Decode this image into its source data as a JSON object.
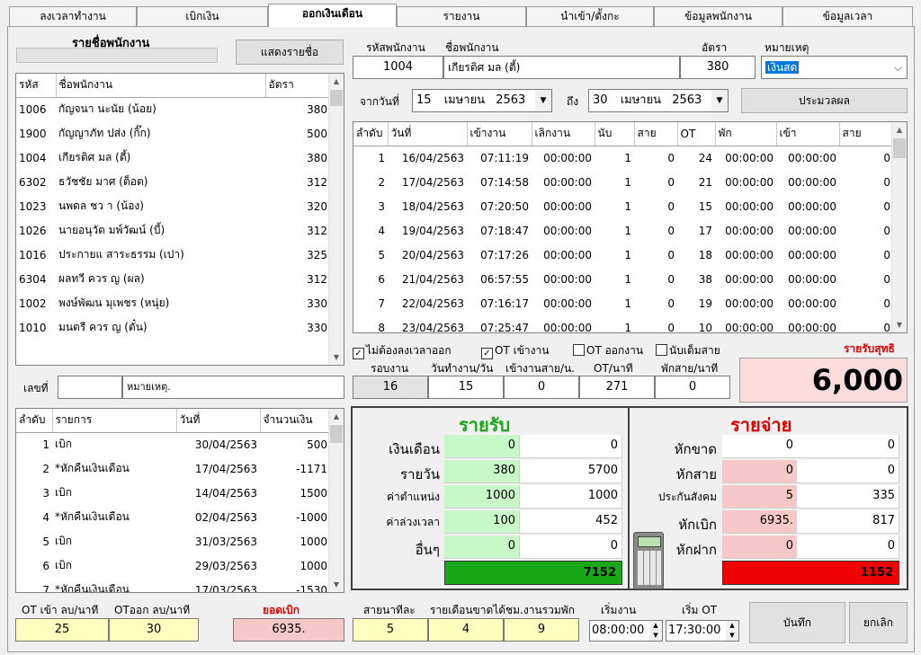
{
  "tabs": [
    "ลงเวลาทำงาน",
    "เบิกเงิน",
    "ออกเงินเดือน",
    "รายงาน",
    "นำเข้า/ตั้งกะ",
    "ข้อมูลพนักงาน",
    "ข้อมูลเวลา"
  ],
  "left": {
    "title": "รายชื่อพนักงาน",
    "show_button": "แสดงรายชื่อ",
    "headers": [
      "รหัส",
      "ชื่อพนักงาน",
      "อัตรา"
    ],
    "employees": [
      {
        "id": "1006",
        "name": "กัญจนา      นะนัย (น้อย)",
        "rate": "380"
      },
      {
        "id": "1900",
        "name": "กัญญาภัท      ปส่ง (กิ๊ก)",
        "rate": "500"
      },
      {
        "id": "1004",
        "name": "เกียรติศ      มล (ตี้)",
        "rate": "380"
      },
      {
        "id": "6302",
        "name": "ธวัชชัย      มาศ (ต็อต)",
        "rate": "312"
      },
      {
        "id": "1023",
        "name": "นพดล ชว      า (น้อง)",
        "rate": "320"
      },
      {
        "id": "1026",
        "name": "นายอนุวัต      มพ์วัฒน์ (บี้)",
        "rate": "312"
      },
      {
        "id": "1016",
        "name": "ประกายแ      สาระธรรม (เปา)",
        "rate": "325"
      },
      {
        "id": "6304",
        "name": "ผลทวี ควร      ญ (ผล)",
        "rate": "312"
      },
      {
        "id": "1002",
        "name": "พงษ์พัฒน      มุเพชร (หนุ่ย)",
        "rate": "330"
      },
      {
        "id": "1010",
        "name": "มนตรี ควร      ญ (ตั๋น)",
        "rate": "330"
      }
    ],
    "doc_label": "เลขที่",
    "note_label": "หมายเหตุ.",
    "tx_headers": [
      "ลำดับ",
      "รายการ",
      "วันที่",
      "จำนวนเงิน"
    ],
    "transactions": [
      {
        "no": "1",
        "item": "เบิก",
        "date": "30/04/2563",
        "amount": "500"
      },
      {
        "no": "2",
        "item": "*หักคืนเงินเดือน",
        "date": "17/04/2563",
        "amount": "-1171"
      },
      {
        "no": "3",
        "item": "เบิก",
        "date": "14/04/2563",
        "amount": "1500"
      },
      {
        "no": "4",
        "item": "*หักคืนเงินเดือน",
        "date": "02/04/2563",
        "amount": "-1000"
      },
      {
        "no": "5",
        "item": "เบิก",
        "date": "31/03/2563",
        "amount": "1000"
      },
      {
        "no": "6",
        "item": "เบิก",
        "date": "29/03/2563",
        "amount": "1000"
      },
      {
        "no": "7",
        "item": "*หักคืนเงินเดือน",
        "date": "17/03/2563",
        "amount": "-1530"
      }
    ]
  },
  "header": {
    "emp_id_label": "รหัสพนักงาน",
    "emp_name_label": "ชื่อพนักงาน",
    "rate_label": "อัตรา",
    "note_label": "หมายเหตุ",
    "emp_id": "1004",
    "emp_name": "เกียรติศ      มล (ตี้)",
    "rate": "380",
    "note": "เงินสด",
    "from_label": "จากวันที่",
    "from_day": "15",
    "from_month": "เมษายน",
    "from_year": "2563",
    "to_label": "ถึง",
    "to_day": "30",
    "to_month": "เมษายน",
    "to_year": "2563",
    "process_button": "ประมวลผล"
  },
  "attendance": {
    "headers": [
      "ลำดับ",
      "วันที่",
      "เข้างาน",
      "เลิกงาน",
      "นับ",
      "สาย",
      "OT",
      "พัก",
      "เข้า",
      "สาย"
    ],
    "rows": [
      [
        "1",
        "16/04/2563",
        "07:11:19",
        "00:00:00",
        "1",
        "0",
        "24",
        "00:00:00",
        "00:00:00",
        "0"
      ],
      [
        "2",
        "17/04/2563",
        "07:14:58",
        "00:00:00",
        "1",
        "0",
        "21",
        "00:00:00",
        "00:00:00",
        "0"
      ],
      [
        "3",
        "18/04/2563",
        "07:20:50",
        "00:00:00",
        "1",
        "0",
        "15",
        "00:00:00",
        "00:00:00",
        "0"
      ],
      [
        "4",
        "19/04/2563",
        "07:18:47",
        "00:00:00",
        "1",
        "0",
        "17",
        "00:00:00",
        "00:00:00",
        "0"
      ],
      [
        "5",
        "20/04/2563",
        "07:17:26",
        "00:00:00",
        "1",
        "0",
        "18",
        "00:00:00",
        "00:00:00",
        "0"
      ],
      [
        "6",
        "21/04/2563",
        "06:57:55",
        "00:00:00",
        "1",
        "0",
        "38",
        "00:00:00",
        "00:00:00",
        "0"
      ],
      [
        "7",
        "22/04/2563",
        "07:16:17",
        "00:00:00",
        "1",
        "0",
        "19",
        "00:00:00",
        "00:00:00",
        "0"
      ],
      [
        "8",
        "23/04/2563",
        "07:25:47",
        "00:00:00",
        "1",
        "0",
        "10",
        "00:00:00",
        "00:00:00",
        "0"
      ]
    ]
  },
  "options": {
    "no_checkout": "ไม่ต้องลงเวลาออก",
    "ot_in": "OT เข้างาน",
    "ot_out": "OT ออกงาน",
    "count_late": "นับเต็มสาย",
    "no_checkout_checked": true,
    "ot_in_checked": true,
    "ot_out_checked": false,
    "count_late_checked": false
  },
  "stats": {
    "labels": [
      "รอบงาน",
      "วันทำงาน/วัน",
      "เข้างานสาย/น.",
      "OT/นาที",
      "พักสาย/นาที"
    ],
    "values": [
      "16",
      "15",
      "0",
      "271",
      "0"
    ]
  },
  "net": {
    "label": "รายรับสุทธิ",
    "value": "6,000"
  },
  "income": {
    "title": "รายรับ",
    "rows": [
      {
        "label": "เงินเดือน",
        "rate": "0",
        "amount": "0"
      },
      {
        "label": "รายวัน",
        "rate": "380",
        "amount": "5700"
      },
      {
        "label": "ค่าตำแหน่ง",
        "rate": "1000",
        "amount": "1000"
      },
      {
        "label": "ค่าล่วงเวลา",
        "rate": "100",
        "amount": "452"
      },
      {
        "label": "อื่นๆ",
        "rate": "0",
        "amount": "0"
      }
    ],
    "total": "7152"
  },
  "expense": {
    "title": "รายจ่าย",
    "rows": [
      {
        "label": "หักขาด",
        "rate": "0",
        "amount": "0"
      },
      {
        "label": "หักสาย",
        "rate": "0",
        "amount": "0"
      },
      {
        "label": "ประกันสังคม",
        "rate": "5",
        "amount": "335"
      },
      {
        "label": "หักเบิก",
        "rate": "6935.",
        "amount": "817"
      },
      {
        "label": "หักฝาก",
        "rate": "0",
        "amount": "0"
      }
    ],
    "total": "1152"
  },
  "bottom": {
    "ot_in_label": "OT เข้า ลบ/นาที",
    "ot_in": "25",
    "ot_out_label": "OTออก ลบ/นาที",
    "ot_out": "30",
    "advance_label": "ยอดเบิก",
    "advance": "6935.",
    "late_label": "สายนาทีละ",
    "late": "5",
    "absent_label": "รายเดือนขาดได้",
    "absent": "4",
    "hours_label": "ชม.งานรวมพัก",
    "hours": "9",
    "start_label": "เริ่มงาน",
    "start": "08:00:00",
    "ot_start_label": "เริ่ม OT",
    "ot_start": "17:30:00",
    "save": "บันทึก",
    "cancel": "ยกเลิก"
  },
  "colors": {
    "green": "#18a818",
    "red": "#f00000",
    "pink": "#f8c8c8",
    "lightgreen": "#c8f8c8",
    "yellow": "#ffffc0",
    "netbg": "#fcdcdc"
  }
}
